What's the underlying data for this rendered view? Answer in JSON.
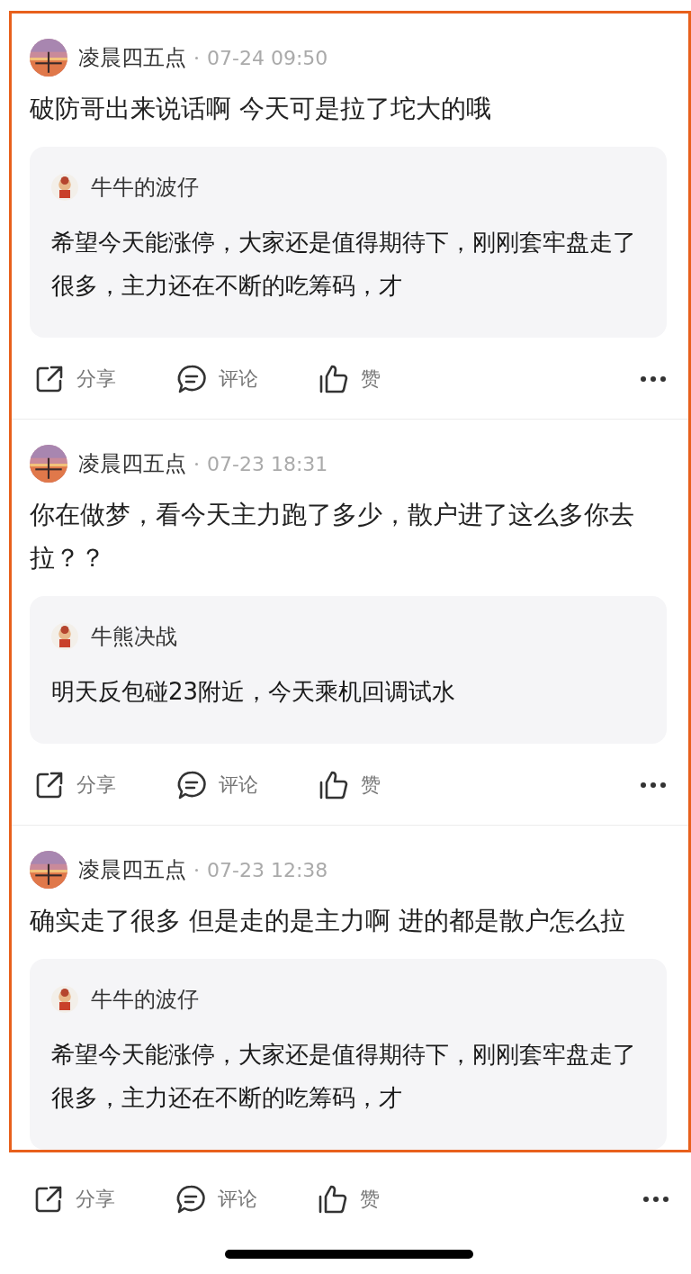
{
  "posts": [
    {
      "author": "凌晨四五点",
      "time": "07-24 09:50",
      "text": "破防哥出来说话啊 今天可是拉了坨大的哦",
      "quote": {
        "author": "牛牛的波仔",
        "text": "希望今天能涨停，大家还是值得期待下，刚刚套牢盘走了很多，主力还在不断的吃筹码，才"
      },
      "actions": {
        "share": "分享",
        "comment": "评论",
        "like": "赞"
      }
    },
    {
      "author": "凌晨四五点",
      "time": "07-23 18:31",
      "text": "你在做梦，看今天主力跑了多少，散户进了这么多你去拉？？",
      "quote": {
        "author": "牛熊决战",
        "text": "明天反包碰23附近，今天乘机回调试水"
      },
      "actions": {
        "share": "分享",
        "comment": "评论",
        "like": "赞"
      }
    },
    {
      "author": "凌晨四五点",
      "time": "07-23 12:38",
      "text": "确实走了很多 但是走的是主力啊 进的都是散户怎么拉",
      "quote": {
        "author": "牛牛的波仔",
        "text": "希望今天能涨停，大家还是值得期待下，刚刚套牢盘走了很多，主力还在不断的吃筹码，才"
      },
      "actions": {
        "share": "分享",
        "comment": "评论",
        "like": "赞"
      }
    }
  ]
}
